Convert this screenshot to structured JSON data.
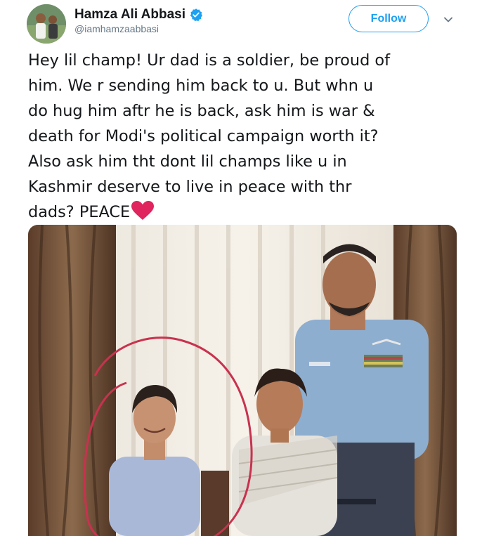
{
  "author": {
    "display_name": "Hamza Ali Abbasi",
    "handle": "@iamhamzaabbasi",
    "verified": true,
    "avatar_icon": "profile-photo"
  },
  "actions": {
    "follow_label": "Follow",
    "menu_icon": "chevron-down-icon"
  },
  "tweet": {
    "text": "Hey lil champ! Ur dad is a soldier, be proud of\nhim. We r sending him back to u. But whn u\ndo hug him aftr he is back, ask him is war &\ndeath for Modi's political campaign worth it?\nAlso ask him tht dont lil champs like u in\nKashmir deserve to live in peace with thr\ndads? PEACE",
    "emoji": "red-heart-icon"
  },
  "media": {
    "type": "photo"
  },
  "colors": {
    "accent": "#1da1f2",
    "text": "#14171a",
    "secondary_text": "#657786",
    "heart": "#e0245e",
    "circle_annotation": "#c8324e"
  }
}
